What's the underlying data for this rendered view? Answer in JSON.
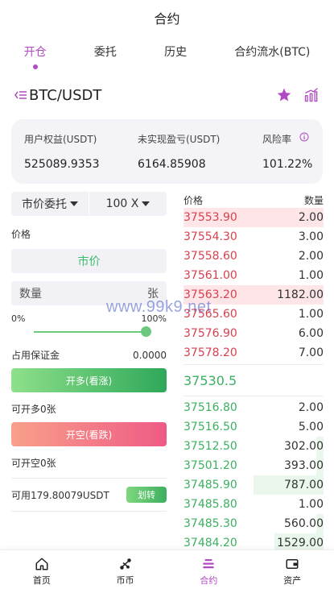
{
  "header": {
    "title": "合约"
  },
  "tabs": [
    {
      "label": "开仓",
      "active": true
    },
    {
      "label": "委托",
      "active": false
    },
    {
      "label": "历史",
      "active": false
    },
    {
      "label": "合约流水(BTC)",
      "active": false
    }
  ],
  "pair": {
    "name": "BTC/USDT"
  },
  "account": {
    "equity_label": "用户权益(USDT)",
    "equity_value": "525089.9353",
    "unrealized_label": "未实现盈亏(USDT)",
    "unrealized_value": "6164.85908",
    "risk_label": "风险率",
    "risk_value": "101.22%"
  },
  "form": {
    "order_type": "市价委托",
    "leverage": "100 X",
    "price_label": "价格",
    "price_value": "市价",
    "qty_placeholder": "数量",
    "qty_unit": "张",
    "slider_min": "0%",
    "slider_max": "100%",
    "slider_value": 1.0,
    "margin_label": "占用保证金",
    "margin_value": "0.0000",
    "long_button": "开多(看涨)",
    "can_long": "可开多0张",
    "short_button": "开空(看跌)",
    "can_short": "可开空0张",
    "available": "可用179.80079USDT",
    "transfer_button": "划转"
  },
  "orderbook": {
    "price_header": "价格",
    "qty_header": "数量",
    "asks": [
      {
        "price": "37553.90",
        "qty": "2.00",
        "depth": 1.0
      },
      {
        "price": "37554.30",
        "qty": "3.00",
        "depth": 0.0
      },
      {
        "price": "37558.60",
        "qty": "2.00",
        "depth": 0.0
      },
      {
        "price": "37561.00",
        "qty": "1.00",
        "depth": 0.0
      },
      {
        "price": "37563.20",
        "qty": "1182.00",
        "depth": 1.0
      },
      {
        "price": "37565.60",
        "qty": "1.00",
        "depth": 0.0
      },
      {
        "price": "37576.90",
        "qty": "6.00",
        "depth": 0.0
      },
      {
        "price": "37578.20",
        "qty": "7.00",
        "depth": 0.0
      }
    ],
    "last_price": "37530.5",
    "bids": [
      {
        "price": "37516.80",
        "qty": "2.00",
        "depth": 0.0
      },
      {
        "price": "37516.50",
        "qty": "5.00",
        "depth": 0.0
      },
      {
        "price": "37512.50",
        "qty": "302.00",
        "depth": 0.05
      },
      {
        "price": "37501.20",
        "qty": "393.00",
        "depth": 0.05
      },
      {
        "price": "37485.90",
        "qty": "787.00",
        "depth": 0.5
      },
      {
        "price": "37485.80",
        "qty": "1.00",
        "depth": 0.0
      },
      {
        "price": "37485.30",
        "qty": "560.00",
        "depth": 0.05
      },
      {
        "price": "37484.20",
        "qty": "1529.00",
        "depth": 0.35
      }
    ]
  },
  "watermark": "www.99k9.net",
  "nav": [
    {
      "label": "首页",
      "icon": "home-icon",
      "active": false
    },
    {
      "label": "币币",
      "icon": "exchange-icon",
      "active": false
    },
    {
      "label": "合约",
      "icon": "contract-icon",
      "active": true
    },
    {
      "label": "资产",
      "icon": "wallet-icon",
      "active": false
    }
  ],
  "colors": {
    "accent": "#b04bc1",
    "ask": "#d9414f",
    "bid": "#3cb061"
  }
}
